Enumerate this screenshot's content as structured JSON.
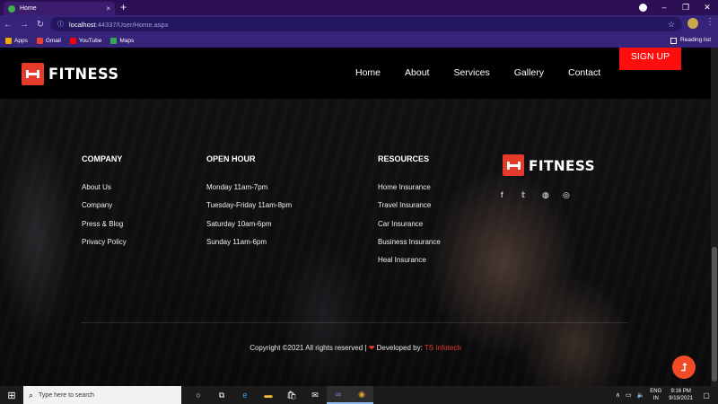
{
  "browser": {
    "tab_title": "Home",
    "tab_close": "×",
    "new_tab": "+",
    "window_controls": [
      "–",
      "❐",
      "✕"
    ],
    "url_host": "localhost",
    "url_path": ":44337/User/Home.aspx",
    "bookmarks": [
      {
        "label": "Apps",
        "icon": "apps-grid-icon",
        "color": "#f2a900"
      },
      {
        "label": "Gmail",
        "icon": "gmail-icon",
        "color": "#ea4335"
      },
      {
        "label": "YouTube",
        "icon": "youtube-icon",
        "color": "#ff0000"
      },
      {
        "label": "Maps",
        "icon": "maps-icon",
        "color": "#34a853"
      }
    ],
    "reading_list": "Reading list"
  },
  "page": {
    "brand": "FITNESS",
    "nav": [
      "Home",
      "About",
      "Services",
      "Gallery",
      "Contact"
    ],
    "signup": "SIGN UP",
    "columns": {
      "company": {
        "title": "COMPANY",
        "items": [
          "About Us",
          "Company",
          "Press & Blog",
          "Privacy Policy"
        ]
      },
      "open_hour": {
        "title": "OPEN HOUR",
        "items": [
          "Monday 11am-7pm",
          "Tuesday-Friday 11am-8pm",
          "Saturday 10am-6pm",
          "Sunday 11am-6pm"
        ]
      },
      "resources": {
        "title": "RESOURCES",
        "items": [
          "Home Insurance",
          "Travel Insurance",
          "Car Insurance",
          "Business Insurance",
          "Heal Insurance"
        ]
      }
    },
    "social": [
      "f",
      "𝕥",
      "◍",
      "◎"
    ],
    "copyright": "Copyright ©2021 All rights reserved |",
    "heart": "❤",
    "developed_by": "Developed by:",
    "developer": "TS Infotech",
    "to_top": "⮥",
    "accent": "#e63a2a",
    "signup_color": "#ff0d0d"
  },
  "taskbar": {
    "search_placeholder": "Type here to search",
    "lang_1": "ENG",
    "lang_2": "IN",
    "time": "9:16 PM",
    "date": "9/19/2021"
  }
}
